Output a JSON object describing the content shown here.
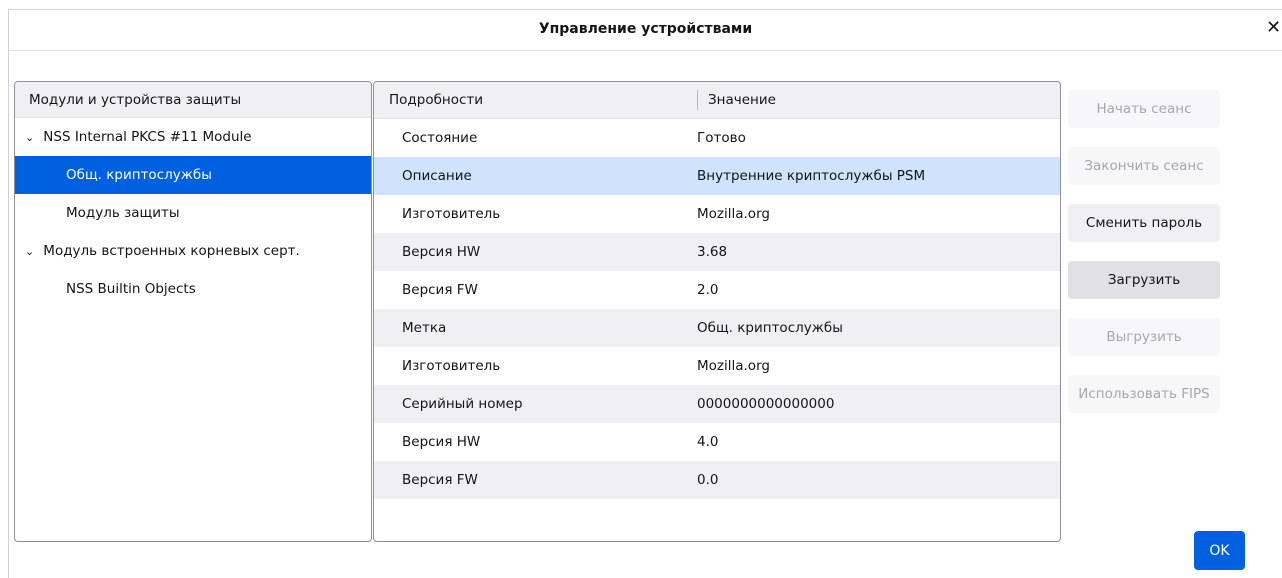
{
  "window": {
    "title": "Управление устройствами",
    "close_glyph": "✕"
  },
  "modules": {
    "header": "Модули и устройства защиты",
    "items": [
      {
        "label": "NSS Internal PKCS #11 Module",
        "expanded": true,
        "twisty": "⌄"
      },
      {
        "label": "Общ. криптослужбы",
        "selected": true
      },
      {
        "label": "Модуль защиты"
      },
      {
        "label": "Модуль встроенных корневых серт.",
        "expanded": true,
        "twisty": "⌄"
      },
      {
        "label": "NSS Builtin Objects"
      }
    ]
  },
  "details": {
    "col_detail": "Подробности",
    "col_value": "Значение",
    "rows": [
      {
        "key": "Состояние",
        "value": "Готово"
      },
      {
        "key": "Описание",
        "value": "Внутренние криптослужбы PSM",
        "selected": true
      },
      {
        "key": "Изготовитель",
        "value": "Mozilla.org"
      },
      {
        "key": "Версия HW",
        "value": "3.68"
      },
      {
        "key": "Версия FW",
        "value": "2.0"
      },
      {
        "key": "Метка",
        "value": "Общ. криптослужбы"
      },
      {
        "key": "Изготовитель",
        "value": "Mozilla.org"
      },
      {
        "key": "Серийный номер",
        "value": "0000000000000000"
      },
      {
        "key": "Версия HW",
        "value": "4.0"
      },
      {
        "key": "Версия FW",
        "value": "0.0"
      }
    ]
  },
  "buttons": {
    "login": "Начать сеанс",
    "logout": "Закончить сеанс",
    "change_password": "Сменить пароль",
    "load": "Загрузить",
    "unload": "Выгрузить",
    "enable_fips": "Использовать FIPS",
    "ok": "OK"
  },
  "colors": {
    "accent": "#0061e0",
    "selected_row": "#cfe3fc",
    "disabled_text": "#a6a6ad"
  }
}
